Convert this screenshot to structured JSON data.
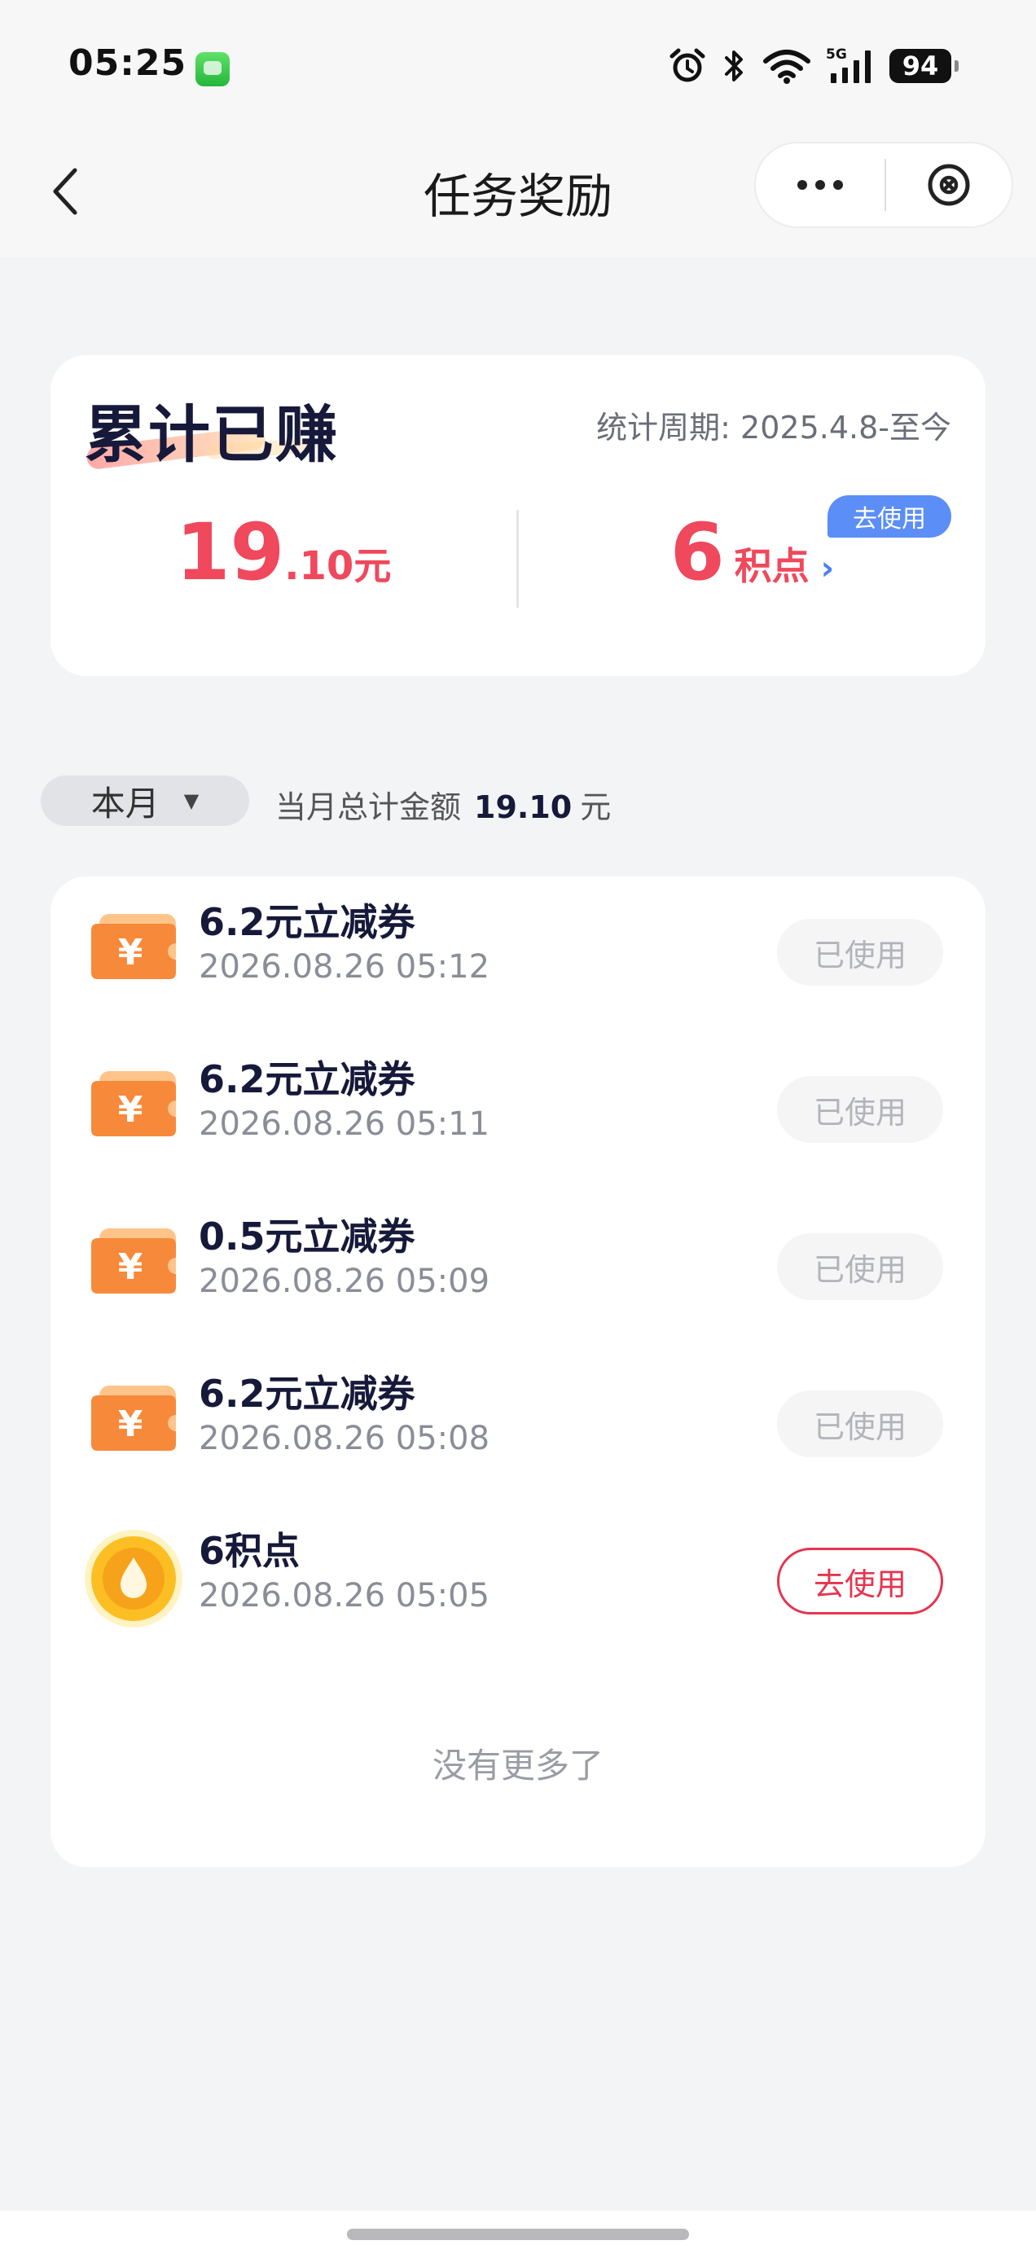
{
  "status_bar": {
    "time": "05:25",
    "app_icon": "messages-app-icon",
    "icons": [
      "alarm-icon",
      "bluetooth-icon",
      "wifi-icon",
      "5g-signal-icon"
    ],
    "network_label": "5G",
    "battery": "94"
  },
  "nav": {
    "title": "任务奖励",
    "back_icon": "chevron-left-icon",
    "more_icon": "more-dots-icon",
    "close_icon": "close-circle-icon"
  },
  "earnings": {
    "title": "累计已赚",
    "period": "统计周期: 2025.4.8-至今",
    "money_int": "19",
    "money_dec": ".10",
    "money_unit": "元",
    "points_num": "6",
    "points_unit": "积点",
    "points_chevron": "›",
    "use_badge": "去使用"
  },
  "filter": {
    "month": "本月",
    "dropdown_arrow": "▼",
    "total_label": "当月总计金额",
    "total_amount": "19.10",
    "total_unit": "元"
  },
  "records": [
    {
      "icon": "coupon-icon",
      "title": "6.2元立减券",
      "time": "2026.08.26 05:12",
      "status": "已使用",
      "status_type": "used"
    },
    {
      "icon": "coupon-icon",
      "title": "6.2元立减券",
      "time": "2026.08.26 05:11",
      "status": "已使用",
      "status_type": "used"
    },
    {
      "icon": "coupon-icon",
      "title": "0.5元立减券",
      "time": "2026.08.26 05:09",
      "status": "已使用",
      "status_type": "used"
    },
    {
      "icon": "coupon-icon",
      "title": "6.2元立减券",
      "time": "2026.08.26 05:08",
      "status": "已使用",
      "status_type": "used"
    },
    {
      "icon": "points-drop-icon",
      "title": "6积点",
      "time": "2026.08.26 05:05",
      "status": "去使用",
      "status_type": "go"
    }
  ],
  "list_footer": "没有更多了",
  "colors": {
    "accent_red": "#f0485c",
    "button_red": "#e5354e",
    "badge_blue": "#5b8ef6",
    "coupon_orange": "#f7893a",
    "drop_yellow": "#fbbf24",
    "background": "#f3f4f6"
  }
}
